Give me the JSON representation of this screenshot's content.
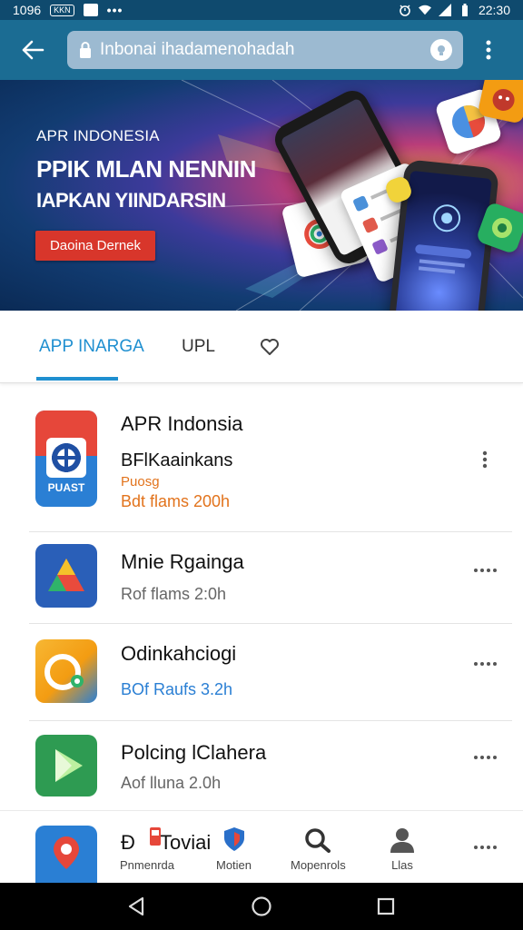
{
  "status_bar": {
    "time_left": "1096",
    "badge": "KKN",
    "time_right": "22:30"
  },
  "browser": {
    "url": "Inbonai ihadamenohadah"
  },
  "banner": {
    "tag": "APR INDONESIA",
    "title": "PPIK MLAN NENNIN",
    "subtitle": "IAPKAN YIINDARSIN",
    "button": "Daoina Dernek"
  },
  "tabs": [
    {
      "label": "APP INARGA"
    },
    {
      "label": "UPL"
    }
  ],
  "apps": [
    {
      "name": "APR Indonsia",
      "subtitle": "BFlKaainkans",
      "tag": "Puosg",
      "meta": "Bdt  flams 200h",
      "icon_text": "PUAST",
      "icon": "target-icon"
    },
    {
      "name": "Mnie Rgainga",
      "meta": "Rof  flams 2:0h",
      "icon": "triangle-prism-icon"
    },
    {
      "name": "Odinkahciogi",
      "meta": "BOf  Raufs 3.2h",
      "icon": "paint-palette-icon"
    },
    {
      "name": "Polcing lClahera",
      "meta": "Aof  lluna 2.0h",
      "icon": "play-store-icon"
    },
    {
      "name": "Toviai",
      "icon": "map-pin-icon"
    }
  ],
  "bottom_nav": [
    {
      "label": "Pnmenrda",
      "icon": "inbox-icon"
    },
    {
      "label": "Motien",
      "icon": "shield-icon"
    },
    {
      "label": "Mopenrols",
      "icon": "search-icon"
    },
    {
      "label": "Llas",
      "icon": "person-icon"
    }
  ],
  "colors": {
    "app_bar": "#1b6c93",
    "accent": "#1f8fd0",
    "banner_button": "#d8362b",
    "tag_orange": "#e2731c"
  }
}
